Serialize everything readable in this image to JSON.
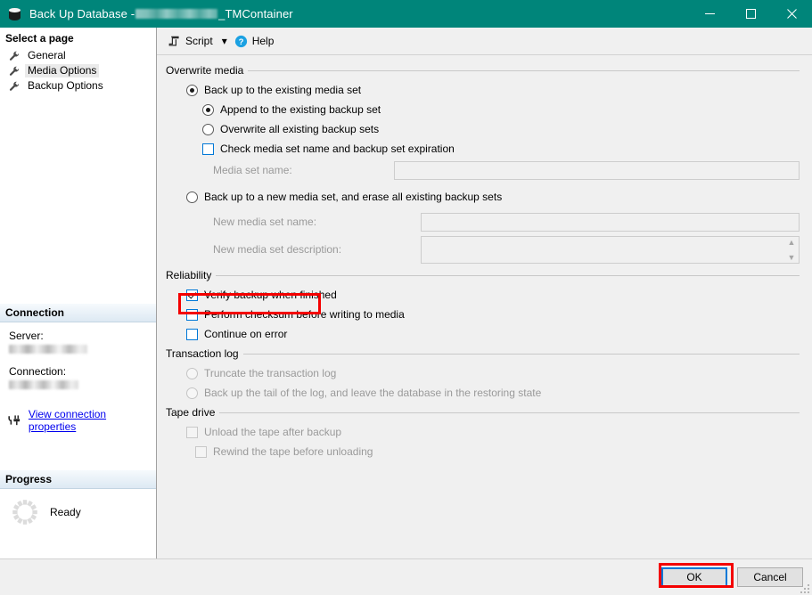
{
  "window": {
    "title_prefix": "Back Up Database - ",
    "title_suffix": "_TMContainer",
    "icon": "database-icon",
    "minimize_label": "Minimize",
    "maximize_label": "Maximize",
    "close_label": "Close",
    "titlebar_color": "#00857a"
  },
  "sidebar": {
    "select_page_header": "Select a page",
    "pages": [
      {
        "label": "General",
        "selected": false
      },
      {
        "label": "Media Options",
        "selected": true
      },
      {
        "label": "Backup Options",
        "selected": false
      }
    ],
    "connection": {
      "header": "Connection",
      "server_label": "Server:",
      "server_value": "",
      "connection_label": "Connection:",
      "connection_value": "",
      "link_label": "View connection properties"
    },
    "progress": {
      "header": "Progress",
      "status": "Ready"
    }
  },
  "toolbar": {
    "script_label": "Script",
    "script_caret": "▾",
    "help_label": "Help"
  },
  "main": {
    "overwrite_media": {
      "title": "Overwrite media",
      "existing_media_set": "Back up to the existing media set",
      "append_existing": "Append to the existing backup set",
      "overwrite_all": "Overwrite all existing backup sets",
      "check_media_set": "Check media set name and backup set expiration",
      "media_set_name_label": "Media set name:",
      "media_set_name_value": "",
      "new_media_set": "Back up to a new media set, and erase all existing backup sets",
      "new_media_set_name_label": "New media set name:",
      "new_media_set_name_value": "",
      "new_media_set_desc_label": "New media set description:",
      "new_media_set_desc_value": ""
    },
    "reliability": {
      "title": "Reliability",
      "verify_backup": "Verify backup when finished",
      "perform_checksum": "Perform checksum before writing to media",
      "continue_on_error": "Continue on error"
    },
    "transaction_log": {
      "title": "Transaction log",
      "truncate": "Truncate the transaction log",
      "tail_log": "Back up the tail of the log, and leave the database in the restoring state"
    },
    "tape_drive": {
      "title": "Tape drive",
      "unload": "Unload the tape after backup",
      "rewind": "Rewind the tape before unloading"
    }
  },
  "footer": {
    "ok_label": "OK",
    "cancel_label": "Cancel"
  },
  "annotations": {
    "color": "#f40000",
    "verify_backup_highlight": "Verify backup when finished",
    "ok_highlight": "OK"
  }
}
